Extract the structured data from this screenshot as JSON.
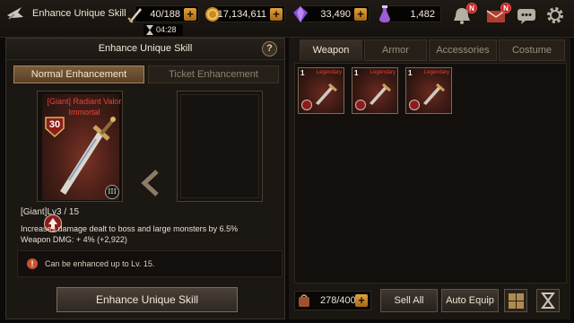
{
  "topbar": {
    "title": "Enhance Unique Skill",
    "stamina": "40/188",
    "timer": "04:28",
    "gold": "17,134,611",
    "gems": "33,490",
    "tickets": "1,482",
    "notification_badge": "N",
    "mail_badge": "N"
  },
  "left": {
    "title": "Enhance Unique Skill",
    "help": "?",
    "tab_normal": "Normal Enhancement",
    "tab_ticket": "Ticket Enhancement",
    "item_name": "[Giant] Radiant Valor Immortal",
    "item_level": "30",
    "item_tier": "III",
    "skill_level": "[Giant]Lv3 / 15",
    "desc1": "Increases damage dealt to boss and large monsters by 6.5%",
    "desc2": "Weapon DMG: + 4% (+2,922)",
    "notice": "Can be enhanced up to Lv. 15.",
    "enhance_button": "Enhance Unique Skill"
  },
  "right": {
    "tabs": [
      "Weapon",
      "Armor",
      "Accessories",
      "Costume"
    ],
    "items": [
      {
        "count": "1",
        "grade": "Legendary"
      },
      {
        "count": "1",
        "grade": "Legendary"
      },
      {
        "count": "1",
        "grade": "Legendary"
      }
    ],
    "bag_capacity": "278/400",
    "sell_all": "Sell All",
    "auto_equip": "Auto Equip"
  }
}
